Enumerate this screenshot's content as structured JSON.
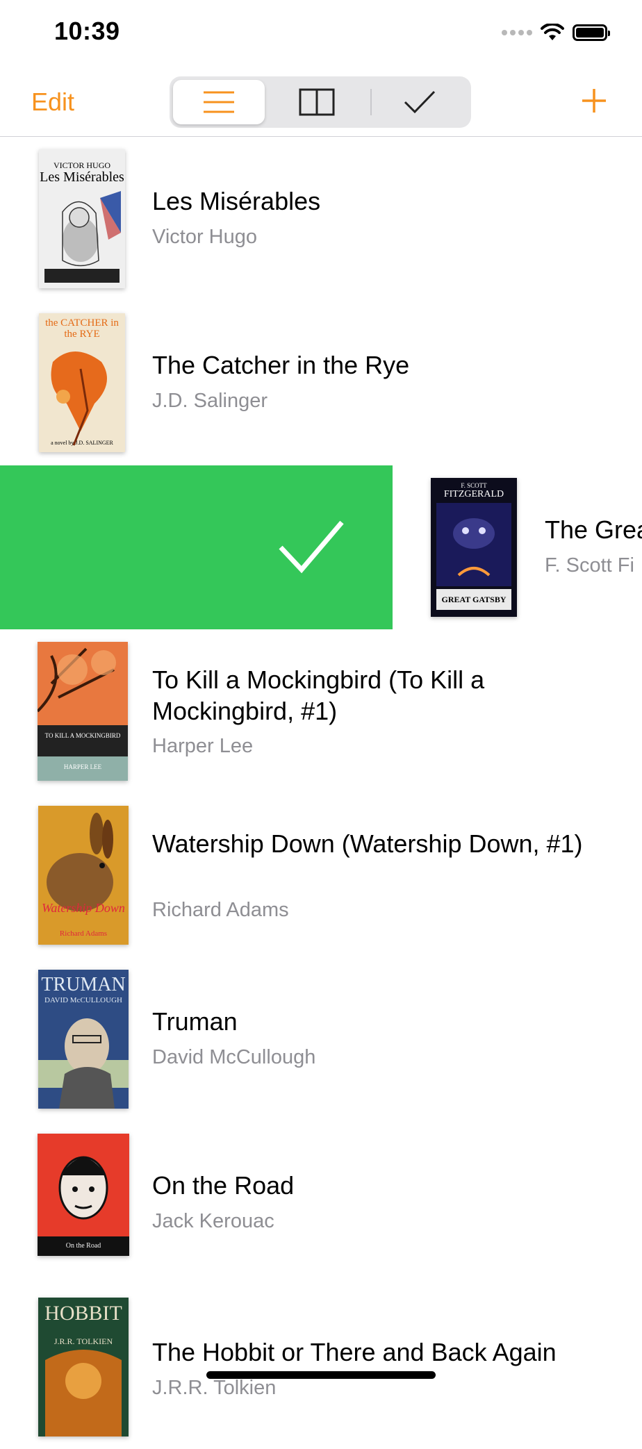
{
  "status_bar": {
    "time": "10:39"
  },
  "nav": {
    "edit_label": "Edit",
    "segments": [
      "list-view",
      "two-column-view",
      "checkmark-view"
    ],
    "selected_segment": "list-view",
    "add_label": "+"
  },
  "accent_color": "#f7921e",
  "swipe_action_color": "#34c759",
  "books": [
    {
      "title": "Les Misérables",
      "author": "Victor Hugo",
      "cover_text": [
        "VICTOR HUGO",
        "Les Misérables"
      ]
    },
    {
      "title": "The Catcher in the Rye",
      "author": "J.D. Salinger",
      "cover_text": [
        "the CATCHER in the RYE",
        "a novel by J.D. SALINGER"
      ]
    },
    {
      "title": "The Grea",
      "author": "F. Scott Fi",
      "cover_text": [
        "F. SCOTT FITZGERALD",
        "THE GREAT GATSBY"
      ]
    },
    {
      "title": "To Kill a Mockingbird (To Kill a Mockingbird, #1)",
      "author": "Harper Lee",
      "cover_text": [
        "TO KILL A MOCKINGBIRD",
        "HARPER LEE"
      ]
    },
    {
      "title": "Watership Down (Watership Down, #1)",
      "author": "Richard  Adams",
      "cover_text": [
        "Watership Down",
        "Richard Adams"
      ]
    },
    {
      "title": "Truman",
      "author": "David McCullough",
      "cover_text": [
        "TRUMAN",
        "DAVID McCULLOUGH"
      ]
    },
    {
      "title": "On the Road",
      "author": "Jack Kerouac",
      "cover_text": [
        "On the Road"
      ]
    },
    {
      "title": "The Hobbit or There and Back Again",
      "author": "J.R.R. Tolkien",
      "cover_text": [
        "HOBBIT",
        "J.R.R. TOLKIEN"
      ]
    }
  ]
}
